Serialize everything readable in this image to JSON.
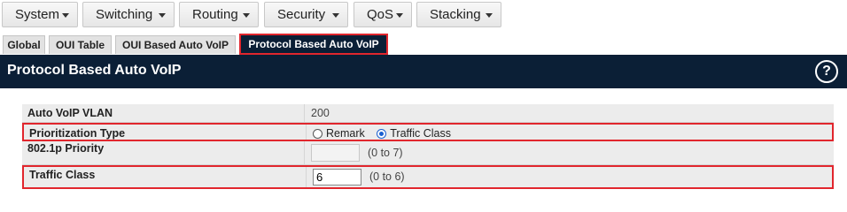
{
  "menu": [
    {
      "label": "System"
    },
    {
      "label": "Switching"
    },
    {
      "label": "Routing"
    },
    {
      "label": "Security"
    },
    {
      "label": "QoS"
    },
    {
      "label": "Stacking"
    }
  ],
  "tabs": [
    {
      "label": "Global"
    },
    {
      "label": "OUI Table"
    },
    {
      "label": "OUI Based Auto VoIP"
    },
    {
      "label": "Protocol Based Auto VoIP",
      "active": true
    }
  ],
  "header": {
    "title": "Protocol Based Auto VoIP",
    "help_symbol": "?"
  },
  "form": {
    "vlan": {
      "label": "Auto VoIP VLAN",
      "value": "200"
    },
    "prioritization": {
      "label": "Prioritization Type",
      "options": [
        "Remark",
        "Traffic Class"
      ],
      "selected": "Traffic Class"
    },
    "dot1p": {
      "label": "802.1p Priority",
      "value": "",
      "range": "(0 to 7)"
    },
    "traffic_class": {
      "label": "Traffic Class",
      "value": "6",
      "range": "(0 to 6)"
    }
  },
  "colors": {
    "header_bg": "#0b1f36",
    "highlight": "#e1262d",
    "radio_selected": "#1a5fd0"
  }
}
